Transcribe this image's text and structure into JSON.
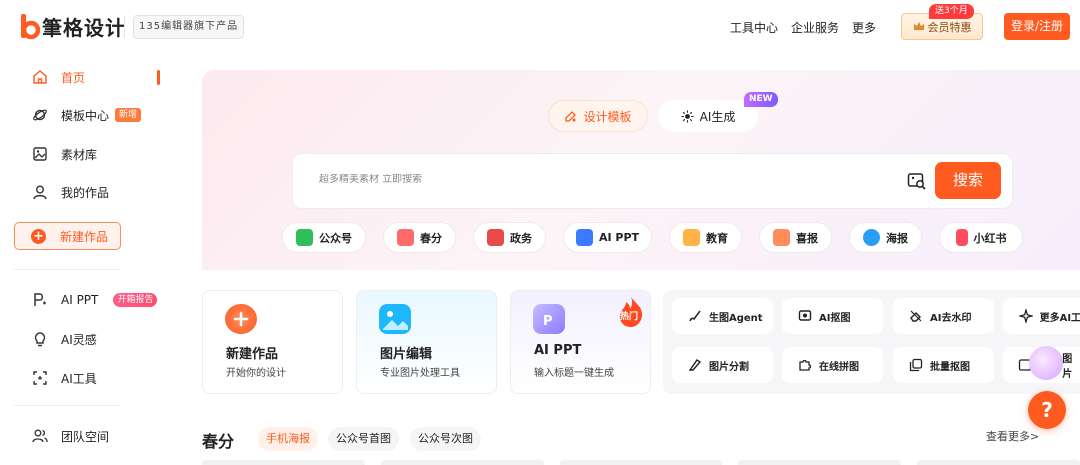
{
  "header": {
    "logo_text": "筆格设计",
    "sub_brand": "135编辑器旗下产品",
    "nav": [
      "工具中心",
      "企业服务",
      "更多"
    ],
    "vip_badge": "送3个月",
    "vip_label": "会员特惠",
    "login_label": "登录/注册"
  },
  "sidebar": {
    "items": [
      {
        "label": "首页",
        "icon": "home-icon",
        "active": true
      },
      {
        "label": "模板中心",
        "icon": "planet-icon",
        "tag": "新增"
      },
      {
        "label": "素材库",
        "icon": "image-icon"
      },
      {
        "label": "我的作品",
        "icon": "user-icon"
      }
    ],
    "new_work": "新建作品",
    "ai_items": [
      {
        "label": "AI PPT",
        "icon": "ppt-icon",
        "tag": "开箱报告"
      },
      {
        "label": "AI灵感",
        "icon": "bulb-icon"
      },
      {
        "label": "AI工具",
        "icon": "scan-icon"
      }
    ],
    "team": "团队空间"
  },
  "hero": {
    "tabs": [
      {
        "label": "设计模板",
        "active": true,
        "icon": "palette-icon"
      },
      {
        "label": "AI生成",
        "active": false,
        "icon": "sparkle-icon"
      }
    ],
    "new_badge": "NEW",
    "search_placeholder": "超多精美素材 立即搜索",
    "search_button": "搜索",
    "categories": [
      {
        "label": "公众号",
        "color": "#2fbf5a"
      },
      {
        "label": "春分",
        "color": "#ff6b6b"
      },
      {
        "label": "政务",
        "color": "#e84a4a"
      },
      {
        "label": "AI PPT",
        "color": "#3b7bff"
      },
      {
        "label": "教育",
        "color": "#ffb347"
      },
      {
        "label": "喜报",
        "color": "#ff8c5a"
      },
      {
        "label": "海报",
        "color": "#2a9df4"
      },
      {
        "label": "小红书",
        "color": "#ff4d5e"
      }
    ]
  },
  "cards": [
    {
      "title": "新建作品",
      "desc": "开始你的设计",
      "color": "#ff6a3d"
    },
    {
      "title": "图片编辑",
      "desc": "专业图片处理工具",
      "color": "#1fb8ff"
    },
    {
      "title": "AI PPT",
      "desc": "输入标题一键生成",
      "color": "#9b8cff",
      "hot": "热门"
    }
  ],
  "tools": {
    "row1": [
      "生图Agent",
      "AI抠图",
      "AI去水印",
      "更多AI工"
    ],
    "row2": [
      "图片分割",
      "在线拼图",
      "批量抠图",
      "图片"
    ]
  },
  "section": {
    "title": "春分",
    "tabs": [
      "手机海报",
      "公众号首图",
      "公众号次图"
    ],
    "more": "查看更多>"
  },
  "help": "?"
}
